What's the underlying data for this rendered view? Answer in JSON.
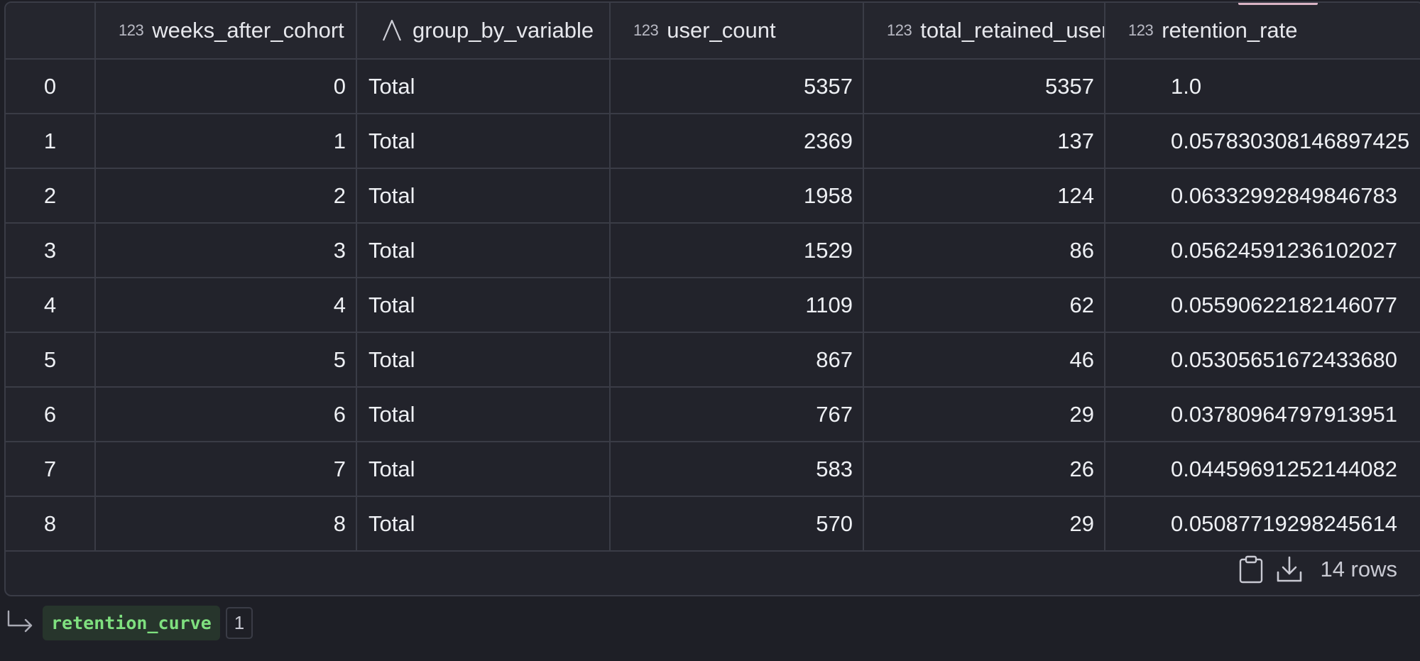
{
  "table": {
    "columns": [
      {
        "label": "",
        "type": ""
      },
      {
        "label": "weeks_after_cohort",
        "type": "123"
      },
      {
        "label": "group_by_variable",
        "type": "string"
      },
      {
        "label": "user_count",
        "type": "123"
      },
      {
        "label": "total_retained_users",
        "type": "123"
      },
      {
        "label": "retention_rate",
        "type": "123"
      }
    ],
    "rows": [
      {
        "idx": "0",
        "weeks": "0",
        "group": "Total",
        "user_count": "5357",
        "retained": "5357",
        "rate": "1.0"
      },
      {
        "idx": "1",
        "weeks": "1",
        "group": "Total",
        "user_count": "2369",
        "retained": "137",
        "rate": "0.057830308146897425"
      },
      {
        "idx": "2",
        "weeks": "2",
        "group": "Total",
        "user_count": "1958",
        "retained": "124",
        "rate": "0.06332992849846783"
      },
      {
        "idx": "3",
        "weeks": "3",
        "group": "Total",
        "user_count": "1529",
        "retained": "86",
        "rate": "0.05624591236102027"
      },
      {
        "idx": "4",
        "weeks": "4",
        "group": "Total",
        "user_count": "1109",
        "retained": "62",
        "rate": "0.05590622182146077"
      },
      {
        "idx": "5",
        "weeks": "5",
        "group": "Total",
        "user_count": "867",
        "retained": "46",
        "rate": "0.05305651672433680"
      },
      {
        "idx": "6",
        "weeks": "6",
        "group": "Total",
        "user_count": "767",
        "retained": "29",
        "rate": "0.03780964797913951"
      },
      {
        "idx": "7",
        "weeks": "7",
        "group": "Total",
        "user_count": "583",
        "retained": "26",
        "rate": "0.04459691252144082"
      },
      {
        "idx": "8",
        "weeks": "8",
        "group": "Total",
        "user_count": "570",
        "retained": "29",
        "rate": "0.05087719298245614"
      }
    ]
  },
  "footer": {
    "row_count_label": "14 rows",
    "copy_icon": "clipboard-icon",
    "download_icon": "download-icon"
  },
  "lineage": {
    "arrow_icon": "return-arrow-icon",
    "dataframe_name": "retention_curve",
    "count": "1"
  }
}
